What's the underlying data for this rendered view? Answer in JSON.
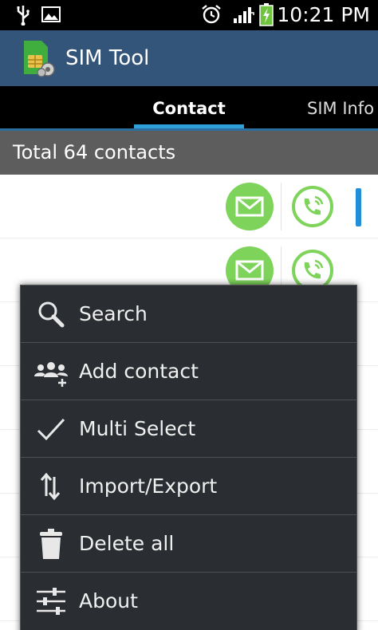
{
  "status_bar": {
    "time": "10:21 PM",
    "icons": [
      "usb-icon",
      "image-icon",
      "alarm-icon",
      "signal-icon",
      "battery-charging-icon"
    ]
  },
  "action_bar": {
    "title": "SIM Tool",
    "icon": "sim-card-icon"
  },
  "tabs": [
    {
      "label": "Contact",
      "selected": true
    },
    {
      "label": "SIM Info",
      "selected": false
    }
  ],
  "header": {
    "total_text": "Total 64 contacts"
  },
  "contact_rows": [
    {
      "actions": [
        "message-icon",
        "call-icon"
      ]
    },
    {
      "actions": [
        "message-icon",
        "call-icon"
      ]
    }
  ],
  "menu": {
    "items": [
      {
        "label": "Search",
        "icon": "search-icon"
      },
      {
        "label": "Add contact",
        "icon": "add-contact-icon"
      },
      {
        "label": "Multi Select",
        "icon": "checkmark-icon"
      },
      {
        "label": "Import/Export",
        "icon": "import-export-icon"
      },
      {
        "label": "Delete all",
        "icon": "trash-icon"
      },
      {
        "label": "About",
        "icon": "settings-sliders-icon"
      }
    ]
  },
  "colors": {
    "action_bar": "#34557a",
    "tab_indicator": "#2f9fd9",
    "message_button": "#7ed45b",
    "call_icon": "#7ed45b",
    "menu_background": "#2a2e32"
  }
}
